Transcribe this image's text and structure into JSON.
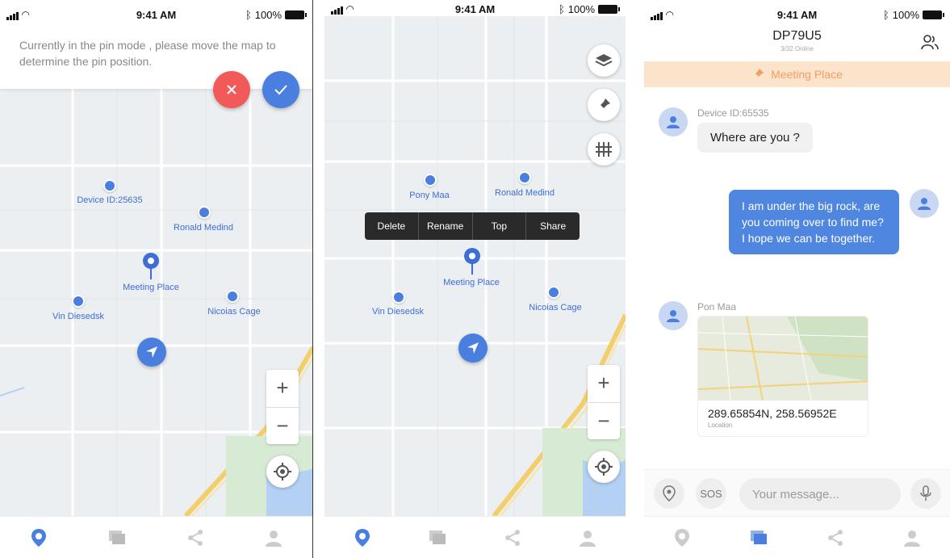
{
  "status_bar": {
    "time": "9:41 AM",
    "battery": "100%"
  },
  "screen1": {
    "pin_mode_message": "Currently in the pin mode , please move the map to determine the pin position.",
    "markers": [
      {
        "label": "Device ID:25635"
      },
      {
        "label": "Ronald Medind"
      },
      {
        "label": "Vin Diesedsk"
      },
      {
        "label": "Nicoias Cage"
      }
    ],
    "meeting_place_label": "Meeting Place",
    "zoom_in": "+",
    "zoom_out": "−"
  },
  "screen2": {
    "markers": [
      {
        "label": "Pony Maa"
      },
      {
        "label": "Ronald Medind"
      },
      {
        "label": "Vin Diesedsk"
      },
      {
        "label": "Nicoias Cage"
      }
    ],
    "meeting_place_label": "Meeting Place",
    "context_menu": [
      "Delete",
      "Rename",
      "Top",
      "Share"
    ],
    "zoom_in": "+",
    "zoom_out": "−"
  },
  "screen3": {
    "chat_title": "DP79U5",
    "chat_subtitle": "3/32 Online",
    "banner": "Meeting Place",
    "messages": [
      {
        "sender": "Device ID:65535",
        "text": "Where are you ?"
      },
      {
        "text": "I am under the big rock, are you coming over to find me? I hope we can be together."
      },
      {
        "sender": "Pon Maa",
        "location": "289.65854N, 258.56952E",
        "location_label": "Location"
      }
    ],
    "sos_label": "SOS",
    "message_placeholder": "Your message..."
  },
  "colors": {
    "accent": "#4a7fe0",
    "cancel": "#f25a5a",
    "banner_bg": "#fbe3cc",
    "banner_text": "#f0a060"
  }
}
